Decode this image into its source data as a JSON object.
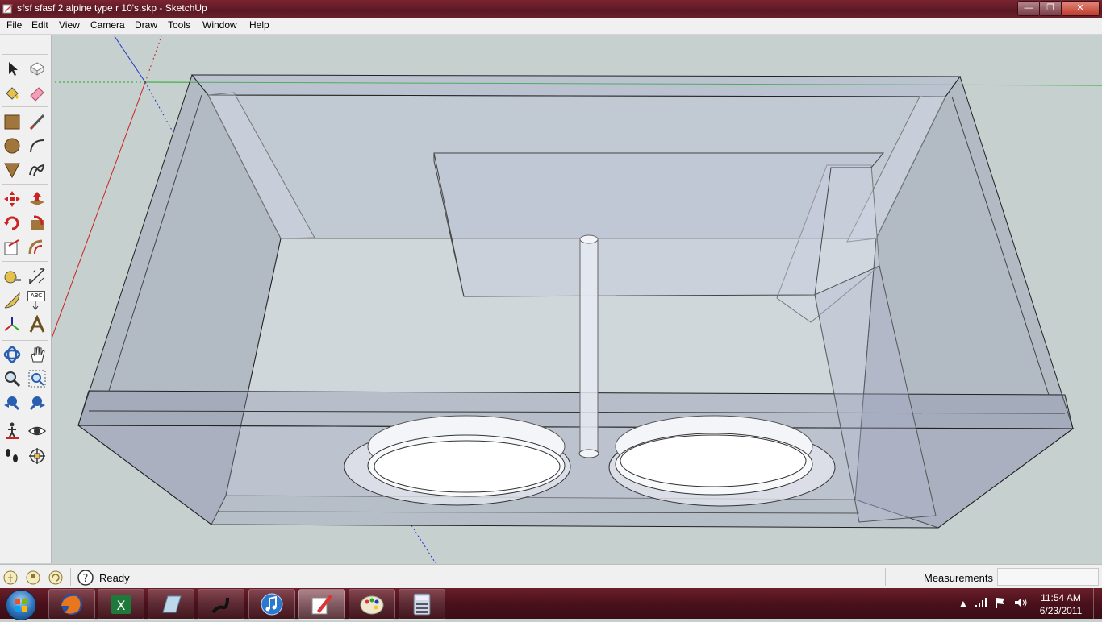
{
  "window": {
    "title": "sfsf sfasf 2 alpine type r 10's.skp - SketchUp",
    "minimize": "—",
    "maximize": "❐",
    "close": "✕"
  },
  "menu": [
    "File",
    "Edit",
    "View",
    "Camera",
    "Draw",
    "Tools",
    "Window",
    "Help"
  ],
  "tools": [
    "select-tool",
    "make-component-tool",
    "paint-bucket-tool",
    "eraser-tool",
    "rectangle-tool",
    "line-tool",
    "circle-tool",
    "arc-tool",
    "polygon-tool",
    "freehand-tool",
    "move-tool",
    "push-pull-tool",
    "rotate-tool",
    "follow-me-tool",
    "scale-tool",
    "offset-tool",
    "tape-measure-tool",
    "dimension-tool",
    "protractor-tool",
    "text-tool",
    "axes-tool",
    "3d-text-tool",
    "orbit-tool",
    "pan-tool",
    "zoom-tool",
    "zoom-window-tool",
    "previous-view-tool",
    "zoom-extents-tool",
    "walk-tool",
    "look-around-tool",
    "position-camera-tool",
    "section-plane-tool"
  ],
  "tool_labels": {
    "dimension": "ABC"
  },
  "status": {
    "text": "Ready",
    "measurements_label": "Measurements",
    "measurements_value": ""
  },
  "taskbar": {
    "apps": [
      "firefox",
      "excel",
      "unknown-app",
      "wand-app",
      "itunes",
      "sketchup",
      "paint",
      "calculator"
    ],
    "active_app": "sketchup",
    "time": "11:54 AM",
    "date": "6/23/2011"
  },
  "colors": {
    "titlebar": "#6b2029",
    "viewport_bg": "#c5d0cf",
    "axis_red": "#cc2222",
    "axis_green": "#22aa22",
    "axis_blue": "#2233cc"
  }
}
